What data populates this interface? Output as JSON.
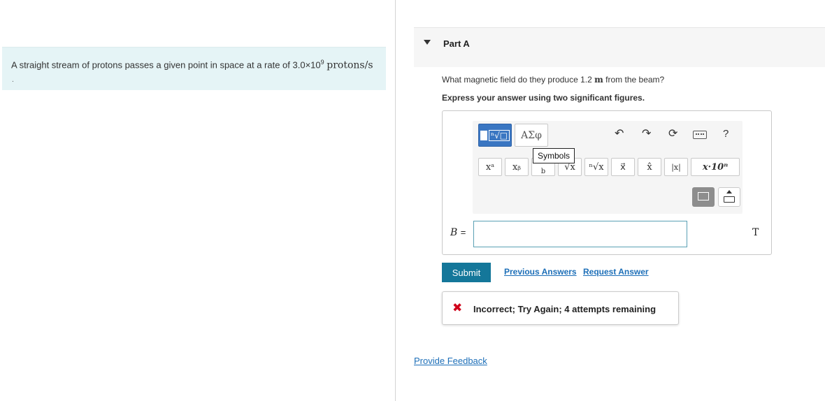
{
  "problem": {
    "text": "A straight stream of protons passes a given point in space at a rate of 3.0×10",
    "exponent": "9",
    "unit": "protons/s",
    "trailing": "."
  },
  "part": {
    "title": "Part A",
    "question_pre": "What magnetic field do they produce 1.2 ",
    "question_unit": "m",
    "question_post": " from the beam?",
    "instruction": "Express your answer using two significant figures."
  },
  "toolbar": {
    "templates_label": "ⁿ√□",
    "symbols_label": "ΑΣφ",
    "tooltip": "Symbols",
    "undo_icon": "undo-icon",
    "redo_icon": "redo-icon",
    "reset_icon": "reset-icon",
    "help_label": "?",
    "buttons": [
      {
        "name": "superscript-button",
        "label": "xᵃ"
      },
      {
        "name": "subscript-button",
        "label": "xᵦ"
      },
      {
        "name": "fraction-button",
        "label": "b"
      },
      {
        "name": "sqrt-button",
        "label": "√x"
      },
      {
        "name": "nthroot-button",
        "label": "ⁿ√x"
      },
      {
        "name": "vector-button",
        "label": "x⃗"
      },
      {
        "name": "unitvector-button",
        "label": "x̂"
      },
      {
        "name": "abs-button",
        "label": "|x|"
      },
      {
        "name": "scientific-button",
        "label": "x·10ⁿ"
      }
    ]
  },
  "answer": {
    "variable": "B",
    "equals": "=",
    "value": "",
    "unit": "T"
  },
  "actions": {
    "submit": "Submit",
    "previous_answers": "Previous Answers",
    "request_answer": "Request Answer"
  },
  "feedback": {
    "message": "Incorrect; Try Again; 4 attempts remaining"
  },
  "footer": {
    "provide_feedback": "Provide Feedback"
  }
}
